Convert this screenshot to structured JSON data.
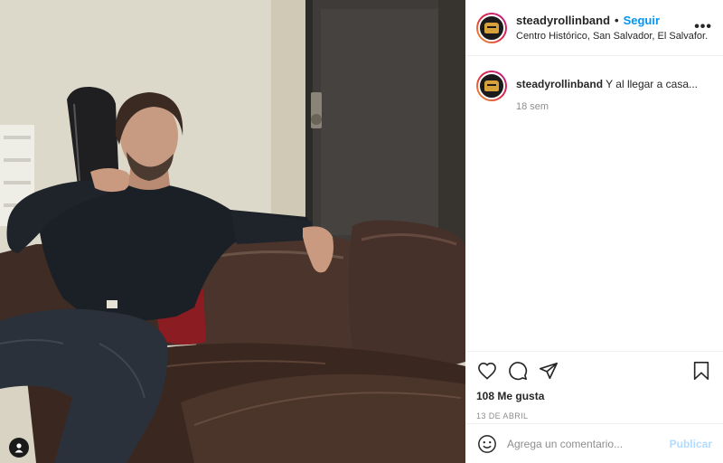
{
  "post": {
    "username": "steadyrollinband",
    "follow_label": "Seguir",
    "separator": "•",
    "location": "Centro Histórico, San Salvador, El Salvafor.",
    "more_label": "•••"
  },
  "caption": {
    "username": "steadyrollinband",
    "text": "Y al llegar a casa...",
    "time": "18 sem"
  },
  "stats": {
    "likes": "108 Me gusta",
    "date": "13 DE ABRIL"
  },
  "comment_box": {
    "placeholder": "Agrega un comentario...",
    "post_label": "Publicar"
  },
  "icons": {
    "like": "heart-icon",
    "comment": "comment-icon",
    "share": "paper-plane-icon",
    "save": "bookmark-icon",
    "emoji": "smiley-icon",
    "user_tag": "user-icon",
    "more": "more-options-icon"
  },
  "colors": {
    "follow": "#0095f6",
    "post_button_disabled": "#b3dbff",
    "secondary_text": "#8e8e8e"
  }
}
